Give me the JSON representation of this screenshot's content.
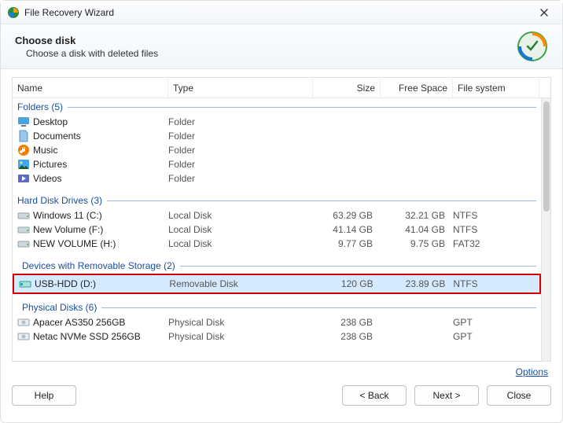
{
  "window": {
    "title": "File Recovery Wizard",
    "heading": "Choose disk",
    "subheading": "Choose a disk with deleted files"
  },
  "columns": {
    "name": "Name",
    "type": "Type",
    "size": "Size",
    "free": "Free Space",
    "fs": "File system"
  },
  "groups": {
    "folders": "Folders (5)",
    "hdd": "Hard Disk Drives (3)",
    "removable": "Devices with Removable Storage (2)",
    "physical": "Physical Disks (6)"
  },
  "folders": [
    {
      "name": "Desktop",
      "type": "Folder",
      "icon": "desktop-icon"
    },
    {
      "name": "Documents",
      "type": "Folder",
      "icon": "documents-icon"
    },
    {
      "name": "Music",
      "type": "Folder",
      "icon": "music-icon"
    },
    {
      "name": "Pictures",
      "type": "Folder",
      "icon": "pictures-icon"
    },
    {
      "name": "Videos",
      "type": "Folder",
      "icon": "videos-icon"
    }
  ],
  "hdd": [
    {
      "name": "Windows 11 (C:)",
      "type": "Local Disk",
      "size": "63.29 GB",
      "free": "32.21 GB",
      "fs": "NTFS"
    },
    {
      "name": "New Volume (F:)",
      "type": "Local Disk",
      "size": "41.14 GB",
      "free": "41.04 GB",
      "fs": "NTFS"
    },
    {
      "name": "NEW VOLUME (H:)",
      "type": "Local Disk",
      "size": "9.77 GB",
      "free": "9.75 GB",
      "fs": "FAT32"
    }
  ],
  "removable": [
    {
      "name": "USB-HDD (D:)",
      "type": "Removable Disk",
      "size": "120 GB",
      "free": "23.89 GB",
      "fs": "NTFS"
    }
  ],
  "physical": [
    {
      "name": "Apacer AS350 256GB",
      "type": "Physical Disk",
      "size": "238 GB",
      "free": "",
      "fs": "GPT"
    },
    {
      "name": "Netac NVMe SSD 256GB",
      "type": "Physical Disk",
      "size": "238 GB",
      "free": "",
      "fs": "GPT"
    }
  ],
  "links": {
    "options": "Options"
  },
  "buttons": {
    "help": "Help",
    "back": "< Back",
    "next": "Next >",
    "close": "Close"
  }
}
